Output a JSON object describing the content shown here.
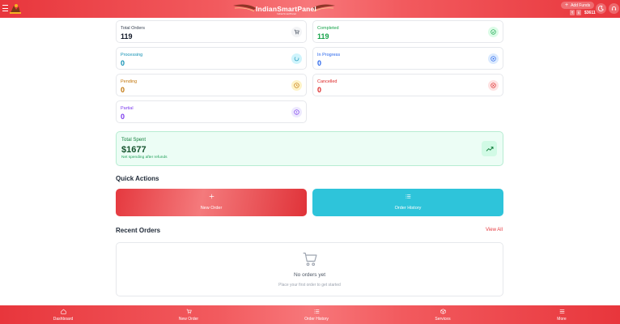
{
  "header": {
    "brand": "IndianSmartPanel",
    "brand_sub": "IndianSmartPanel",
    "add_funds_label": "Add Funds",
    "currency_chips": [
      "₹",
      "$"
    ],
    "balance": "$3611"
  },
  "stats": [
    {
      "label": "Total Orders",
      "value": "119",
      "icon": "cart-icon",
      "color": "#374151",
      "icon_bg": "#f3f4f6"
    },
    {
      "label": "Completed",
      "value": "119",
      "icon": "check-circle-icon",
      "color": "#16a34a",
      "icon_bg": "#dcfce7"
    },
    {
      "label": "Processing",
      "value": "0",
      "icon": "spinner-icon",
      "color": "#0e8fb3",
      "icon_bg": "#cff4fc"
    },
    {
      "label": "In Progress",
      "value": "0",
      "icon": "play-circle-icon",
      "color": "#2563eb",
      "icon_bg": "#dbeafe"
    },
    {
      "label": "Pending",
      "value": "0",
      "icon": "clock-icon",
      "color": "#c2750a",
      "icon_bg": "#fef3c7"
    },
    {
      "label": "Cancelled",
      "value": "0",
      "icon": "x-circle-icon",
      "color": "#dc2626",
      "icon_bg": "#fee2e2"
    },
    {
      "label": "Partial",
      "value": "0",
      "icon": "alert-circle-icon",
      "color": "#7c3aed",
      "icon_bg": "#ede9fe"
    }
  ],
  "spent": {
    "label": "Total Spent",
    "value": "$1677",
    "sub": "Net spending after refunds",
    "icon": "trending-up-icon"
  },
  "quick_actions": {
    "title": "Quick Actions",
    "new_order": "New Order",
    "order_history": "Order History"
  },
  "recent_orders": {
    "title": "Recent Orders",
    "view_all": "View All",
    "empty_title": "No orders yet",
    "empty_sub": "Place your first order to get started"
  },
  "bottom_nav": [
    {
      "label": "Dashboard",
      "icon": "home-icon"
    },
    {
      "label": "New Order",
      "icon": "cart-icon"
    },
    {
      "label": "Order History",
      "icon": "list-icon"
    },
    {
      "label": "Services",
      "icon": "box-icon"
    },
    {
      "label": "More",
      "icon": "menu-icon"
    }
  ],
  "colors": {
    "brand_red": "#e8363c",
    "history_cyan": "#2ec4da",
    "spent_green": "#ecfdf5"
  }
}
